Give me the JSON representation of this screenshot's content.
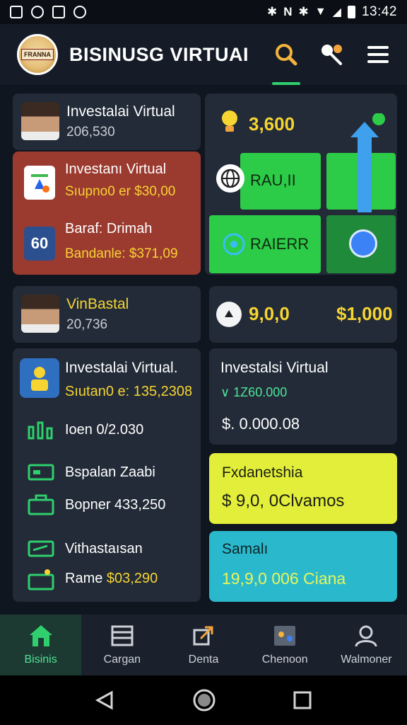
{
  "status_bar": {
    "time": "13:42",
    "left_icons": [
      "square-icon",
      "alarm-icon",
      "gallery-icon",
      "chat-icon"
    ],
    "right_icons": [
      "bluetooth-icon",
      "nfc-icon",
      "vibrate-icon",
      "wifi-icon",
      "signal-icon",
      "battery-icon"
    ],
    "nfc_label": "N"
  },
  "header": {
    "logo_text": "FRANNA",
    "title": "BISINUSG VIRTUAI"
  },
  "cards": {
    "investor1": {
      "name": "Investalai Virtual",
      "value": "206,530"
    },
    "red": {
      "item1_title": "Investanı Virtual",
      "item1_sub": "Sıupno0 er $30,00",
      "item2_badge": "60",
      "item2_title": "Baraf: Drimah",
      "item2_sub": "Bandanle: $371,09"
    },
    "top_right": {
      "amount": "3,600",
      "tile1_label": "RAU,II",
      "tile2_label": "RAIERR"
    },
    "investor2": {
      "name": "VinBastal",
      "value": "20,736"
    },
    "balance": {
      "left": "9,0,0",
      "right": "$1,000"
    },
    "main_list": {
      "title": "Investalai Virtual.",
      "sub": "Sıutan0 e: 135,2308",
      "row1": "Ioen 0/2.030",
      "row2": "Bspalan Zaabi",
      "row3": "Bopner 433,250",
      "row4": "Vithastaısan",
      "row5_label": "Rame",
      "row5_value": "$03,290"
    },
    "investment": {
      "title": "Investalsi Virtual",
      "change": "∨ 1Z60.000",
      "amount": "$. 0.000.08"
    },
    "yellow_card": {
      "title": "Fxdanetshia",
      "value": "$ 9,0, 0Clvamos"
    },
    "cyan_card": {
      "title": "Samalı",
      "value": "19,9,0 006 Ciana"
    }
  },
  "bottom_nav": [
    {
      "label": "Bisinis",
      "icon": "home-icon",
      "active": true
    },
    {
      "label": "Cargan",
      "icon": "list-icon",
      "active": false
    },
    {
      "label": "Denta",
      "icon": "share-icon",
      "active": false
    },
    {
      "label": "Chenoon",
      "icon": "board-icon",
      "active": false
    },
    {
      "label": "Walmoner",
      "icon": "user-icon",
      "active": false
    }
  ],
  "colors": {
    "accent_green": "#2fcf6d",
    "red_card": "#9b3a2f",
    "yellow_text": "#f6d432",
    "yellow_card": "#e3ee3a",
    "cyan_card": "#2ab9cc",
    "tile_green": "#2dcc48"
  }
}
